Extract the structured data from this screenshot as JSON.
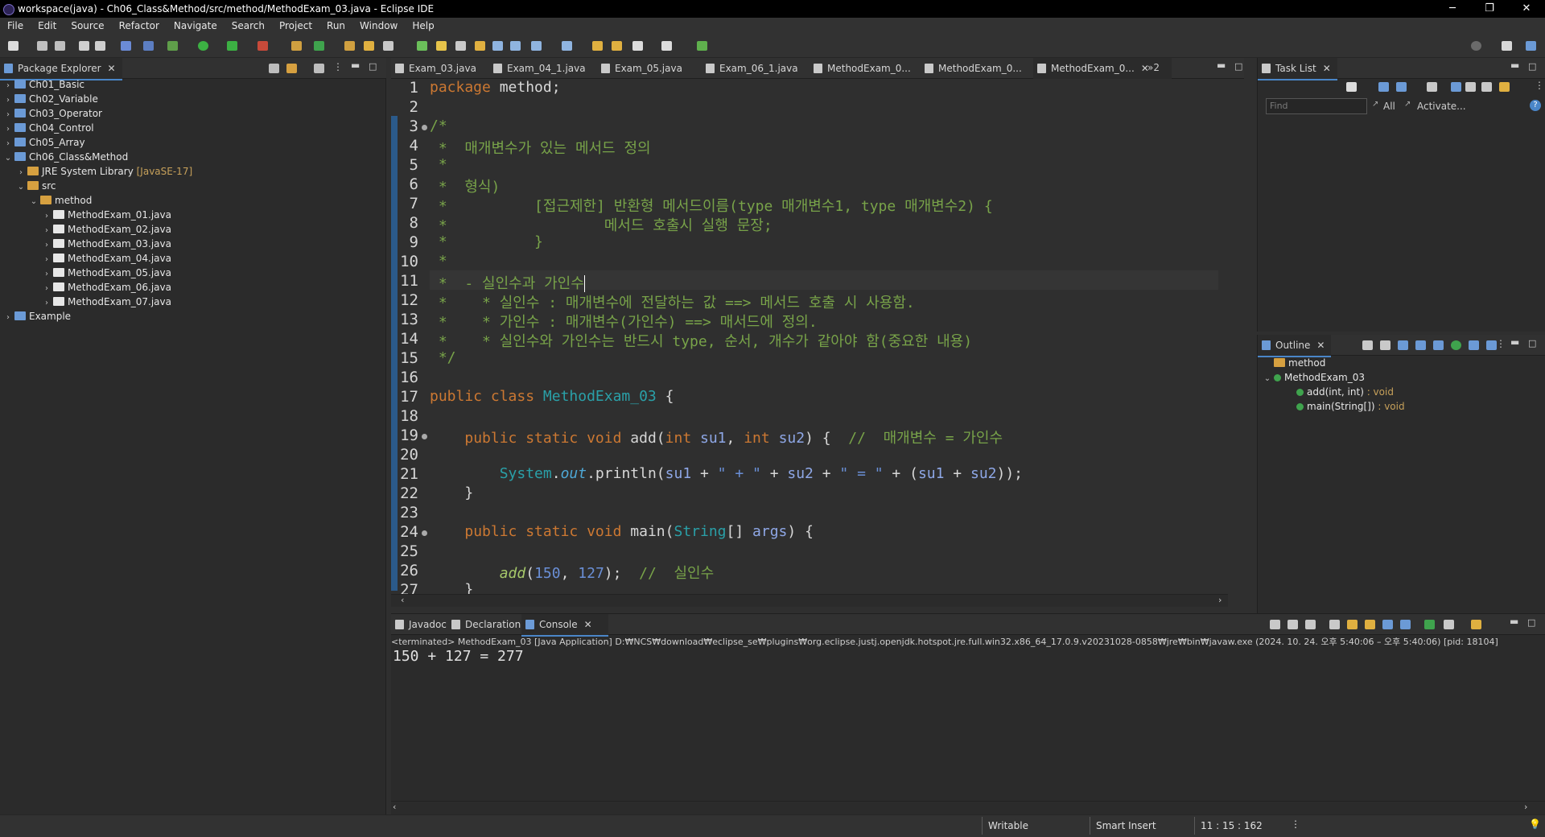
{
  "window": {
    "title": "workspace(java) - Ch06_Class&Method/src/method/MethodExam_03.java - Eclipse IDE"
  },
  "menu": [
    "File",
    "Edit",
    "Source",
    "Refactor",
    "Navigate",
    "Search",
    "Project",
    "Run",
    "Window",
    "Help"
  ],
  "package_explorer": {
    "title": "Package Explorer",
    "items": [
      {
        "label": "Ch01_Basic",
        "indent": 0,
        "twisty": "›",
        "icon": "project"
      },
      {
        "label": "Ch02_Variable",
        "indent": 0,
        "twisty": "›",
        "icon": "project"
      },
      {
        "label": "Ch03_Operator",
        "indent": 0,
        "twisty": "›",
        "icon": "project"
      },
      {
        "label": "Ch04_Control",
        "indent": 0,
        "twisty": "›",
        "icon": "project"
      },
      {
        "label": "Ch05_Array",
        "indent": 0,
        "twisty": "›",
        "icon": "project"
      },
      {
        "label": "Ch06_Class&Method",
        "indent": 0,
        "twisty": "⌄",
        "icon": "project"
      },
      {
        "label": "JRE System Library",
        "suffix": "[JavaSE-17]",
        "indent": 1,
        "twisty": "›",
        "icon": "library"
      },
      {
        "label": "src",
        "indent": 1,
        "twisty": "⌄",
        "icon": "folder"
      },
      {
        "label": "method",
        "indent": 2,
        "twisty": "⌄",
        "icon": "package"
      },
      {
        "label": "MethodExam_01.java",
        "indent": 3,
        "twisty": "›",
        "icon": "java"
      },
      {
        "label": "MethodExam_02.java",
        "indent": 3,
        "twisty": "›",
        "icon": "java"
      },
      {
        "label": "MethodExam_03.java",
        "indent": 3,
        "twisty": "›",
        "icon": "java"
      },
      {
        "label": "MethodExam_04.java",
        "indent": 3,
        "twisty": "›",
        "icon": "java"
      },
      {
        "label": "MethodExam_05.java",
        "indent": 3,
        "twisty": "›",
        "icon": "java"
      },
      {
        "label": "MethodExam_06.java",
        "indent": 3,
        "twisty": "›",
        "icon": "java"
      },
      {
        "label": "MethodExam_07.java",
        "indent": 3,
        "twisty": "›",
        "icon": "java"
      },
      {
        "label": "Example",
        "indent": 0,
        "twisty": "›",
        "icon": "project"
      }
    ]
  },
  "editor_tabs": [
    {
      "label": "Exam_03.java",
      "active": false
    },
    {
      "label": "Exam_04_1.java",
      "active": false
    },
    {
      "label": "Exam_05.java",
      "active": false
    },
    {
      "label": "Exam_06_1.java",
      "active": false
    },
    {
      "label": "MethodExam_0...",
      "active": false
    },
    {
      "label": "MethodExam_0...",
      "active": false
    },
    {
      "label": "MethodExam_0...",
      "active": true
    }
  ],
  "overflow_label": "»2",
  "code_lines": [
    {
      "n": "1",
      "html": "<span class='k'>package</span> method;"
    },
    {
      "n": "2",
      "html": ""
    },
    {
      "n": "3",
      "html": "<span class='c'>/*</span>"
    },
    {
      "n": "4",
      "html": "<span class='c'> *  매개변수가 있는 메서드 정의</span>"
    },
    {
      "n": "5",
      "html": "<span class='c'> *</span>"
    },
    {
      "n": "6",
      "html": "<span class='c'> *  형식)</span>"
    },
    {
      "n": "7",
      "html": "<span class='c'> *          [접근제한] 반환형 메서드이름(type 매개변수1, type 매개변수2) {</span>"
    },
    {
      "n": "8",
      "html": "<span class='c'> *                  메서드 호출시 실행 문장;</span>"
    },
    {
      "n": "9",
      "html": "<span class='c'> *          }</span>"
    },
    {
      "n": "10",
      "html": "<span class='c'> *</span>"
    },
    {
      "n": "11",
      "html": "<span class='c'> *  - 실인수과 가인수</span><span style='border-left:1px solid #fff'></span>"
    },
    {
      "n": "12",
      "html": "<span class='c'> *    * 실인수 : 매개변수에 전달하는 값 ==> 메서드 호출 시 사용함.</span>"
    },
    {
      "n": "13",
      "html": "<span class='c'> *    * 가인수 : 매개변수(가인수) ==> 매서드에 정의.</span>"
    },
    {
      "n": "14",
      "html": "<span class='c'> *    * 실인수와 가인수는 반드시 type, 순서, 개수가 같아야 함(중요한 내용)</span>"
    },
    {
      "n": "15",
      "html": "<span class='c'> */</span>"
    },
    {
      "n": "16",
      "html": ""
    },
    {
      "n": "17",
      "html": "<span class='k'>public class</span> <span class='cls'>MethodExam_03</span> {"
    },
    {
      "n": "18",
      "html": ""
    },
    {
      "n": "19",
      "html": "    <span class='k'>public static void</span> <span class='m'>add</span>(<span class='k'>int</span> <span class='v'>su1</span>, <span class='k'>int</span> <span class='v'>su2</span>) {  <span class='c'>//  매개변수 = 가인수</span>"
    },
    {
      "n": "20",
      "html": ""
    },
    {
      "n": "21",
      "html": "        <span class='cls'>System</span>.<span class='f it'>out</span>.println(<span class='v'>su1</span> + <span class='s'>\" + \"</span> + <span class='v'>su2</span> + <span class='s'>\" = \"</span> + (<span class='v'>su1</span> + <span class='v'>su2</span>));"
    },
    {
      "n": "22",
      "html": "    }"
    },
    {
      "n": "23",
      "html": ""
    },
    {
      "n": "24",
      "html": "    <span class='k'>public static void</span> <span class='m'>main</span>(<span class='cls'>String</span>[] <span class='v'>args</span>) {"
    },
    {
      "n": "25",
      "html": ""
    },
    {
      "n": "26",
      "html": "        <span class='c it' style='color:#a6c86a'>add</span>(<span class='num'>150</span>, <span class='num'>127</span>);  <span class='c'>//  실인수</span>"
    },
    {
      "n": "27",
      "html": "    }"
    }
  ],
  "task_list": {
    "title": "Task List",
    "find_placeholder": "Find",
    "all_label": "All",
    "activate_label": "Activate..."
  },
  "outline": {
    "title": "Outline",
    "items": [
      {
        "label": "method",
        "suffix": "",
        "indent": 0,
        "icon": "package"
      },
      {
        "label": "MethodExam_03",
        "suffix": "",
        "indent": 0,
        "icon": "class",
        "twisty": "⌄"
      },
      {
        "label": "add(int, int)",
        "suffix": " : void",
        "indent": 1,
        "icon": "method"
      },
      {
        "label": "main(String[])",
        "suffix": " : void",
        "indent": 1,
        "icon": "method"
      }
    ]
  },
  "bottom_tabs": [
    {
      "label": "Javadoc",
      "active": false
    },
    {
      "label": "Declaration",
      "active": false
    },
    {
      "label": "Console",
      "active": true
    }
  ],
  "console": {
    "header": "<terminated> MethodExam_03 [Java Application] D:₩NCS₩download₩eclipse_se₩plugins₩org.eclipse.justj.openjdk.hotspot.jre.full.win32.x86_64_17.0.9.v20231028-0858₩jre₩bin₩javaw.exe  (2024. 10. 24. 오후 5:40:06 – 오후 5:40:06) [pid: 18104]",
    "output": "150 + 127 = 277"
  },
  "status": {
    "writable": "Writable",
    "insert_mode": "Smart Insert",
    "position": "11 : 15 : 162"
  }
}
